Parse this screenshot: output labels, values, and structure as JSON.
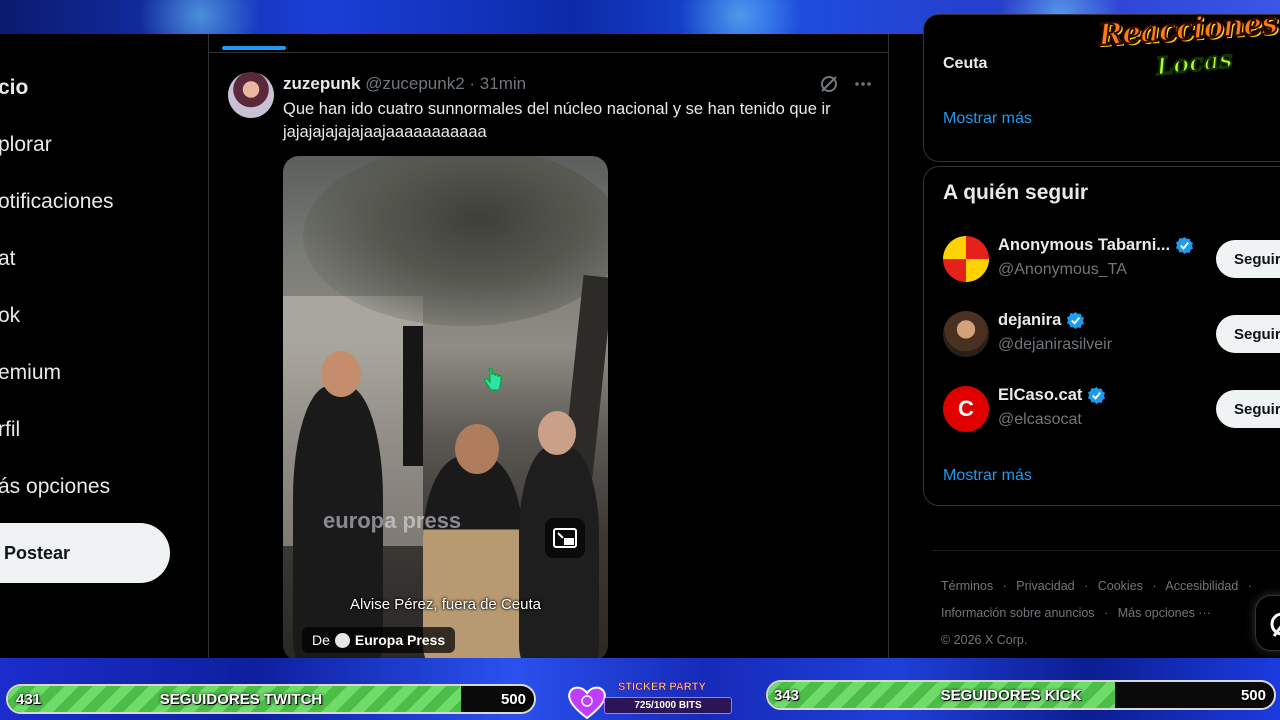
{
  "nav": {
    "items": [
      {
        "label": "cio",
        "bold": true
      },
      {
        "label": "plorar"
      },
      {
        "label": "otificaciones"
      },
      {
        "label": "at"
      },
      {
        "label": "ok"
      },
      {
        "label": "emium"
      },
      {
        "label": "rfil"
      },
      {
        "label": "ás opciones"
      }
    ],
    "post_label": "Postear"
  },
  "tweet": {
    "name": "zuzepunk",
    "handle": "@zucepunk2",
    "time": "· 31min",
    "text": "Que han ido cuatro sunnormales del núcleo nacional y se han tenido que ir jajajajajajajaajaaaaaaaaaaa",
    "media": {
      "caption": "Alvise Pérez, fuera de Ceuta",
      "source_prefix": "De",
      "source_name": "Europa Press",
      "watermark": "europa press"
    }
  },
  "right": {
    "trend_label": "Ceuta",
    "show_more_1": "Mostrar más",
    "who_to_follow_title": "A quién seguir",
    "suggestions": [
      {
        "name": "Anonymous Tabarni...",
        "handle": "@Anonymous_TA",
        "follow": "Seguir",
        "verified": true
      },
      {
        "name": "dejanira",
        "handle": "@dejanirasilveir",
        "follow": "Seguir",
        "verified": true
      },
      {
        "name": "ElCaso.cat",
        "handle": "@elcasocat",
        "follow": "Seguir",
        "verified": true
      }
    ],
    "show_more_2": "Mostrar más",
    "footer": {
      "links_row1": [
        "Términos",
        "·",
        "Privacidad",
        "·",
        "Cookies",
        "·",
        "Accesibilidad",
        "·"
      ],
      "links_row2": [
        "Información sobre anuncios",
        "·",
        "Más opciones ···"
      ],
      "copyright": "© 2026 X Corp."
    }
  },
  "overlay": {
    "logo_line1": "Reacciones",
    "logo_line2": "Locas",
    "twitch": {
      "current": "431",
      "label": "SEGUIDORES TWITCH",
      "goal": "500",
      "progress": 0.862
    },
    "kick": {
      "current": "343",
      "label": "SEGUIDORES KICK",
      "goal": "500",
      "progress": 0.686
    },
    "sticker_title": "STICKER PARTY",
    "sticker_bits": "725/1000 BITS"
  },
  "colors": {
    "accent": "#1d9bf0",
    "background": "#000000",
    "text": "#e7e9ea",
    "muted": "#71767b",
    "progress_green": "#6fdc6a"
  }
}
